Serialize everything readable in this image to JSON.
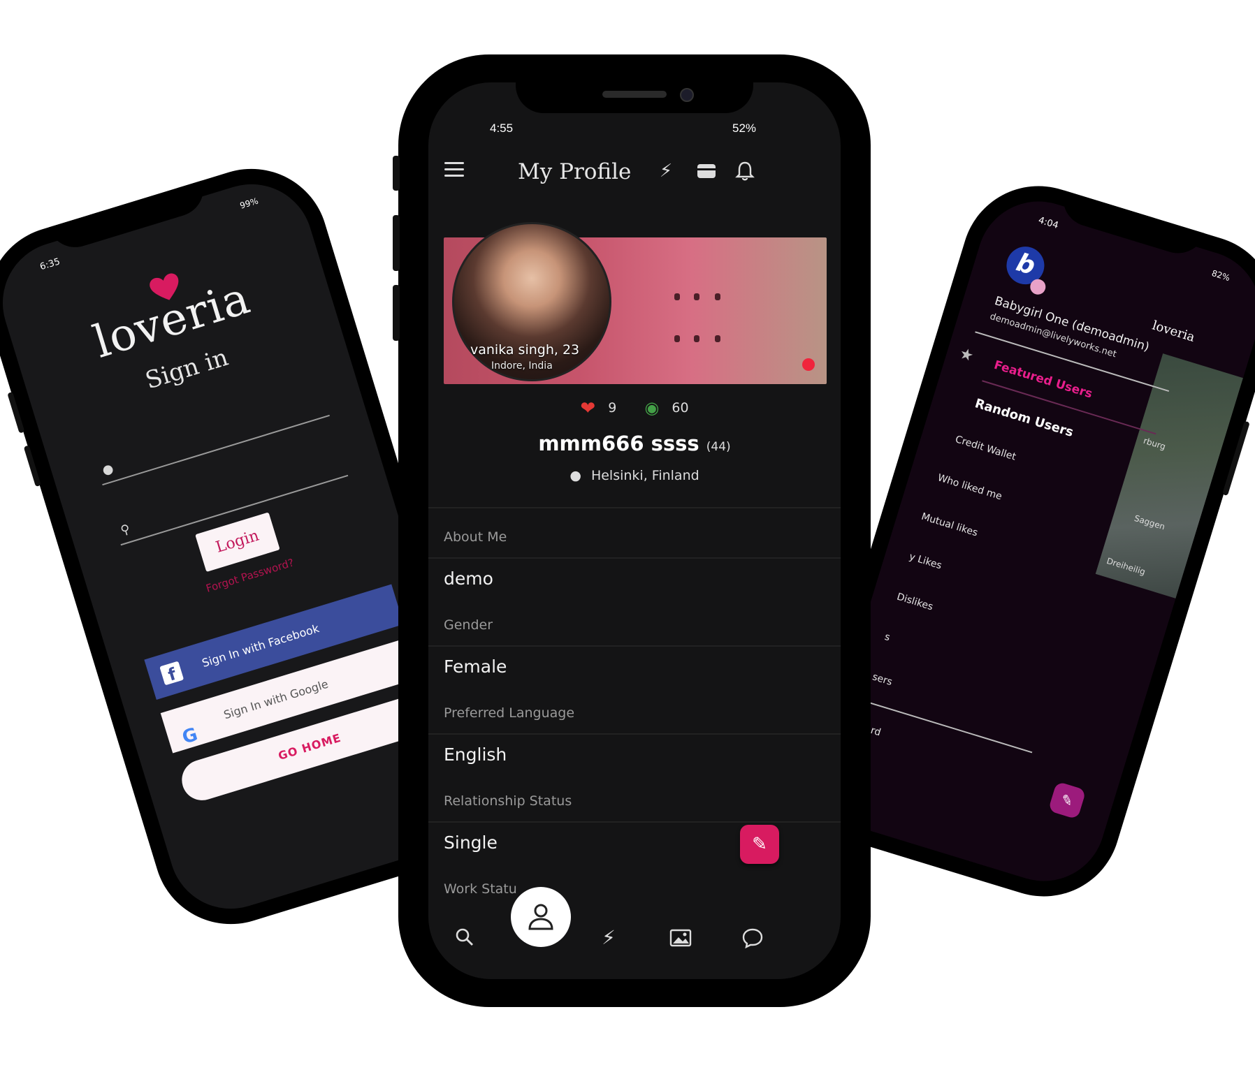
{
  "left_phone": {
    "status_time": "6:35",
    "status_battery": "99%",
    "brand": "loveria",
    "title": "Sign in",
    "login_label": "Login",
    "forgot_label": "Forgot Password?",
    "facebook_label": "Sign In with Facebook",
    "google_label": "Sign In with Google",
    "go_home_label": "GO HOME",
    "icons": {
      "user": "user-icon",
      "key": "key-icon",
      "facebook": "facebook-icon",
      "google": "google-icon"
    }
  },
  "center_phone": {
    "status_time": "4:55",
    "status_battery": "52%",
    "app_title": "My Profile",
    "photo_name": "vanika singh, 23",
    "photo_location": "Indore, India",
    "likes_count": "9",
    "views_count": "60",
    "username": "mmm666 ssss",
    "age": "(44)",
    "location": "Helsinki, Finland",
    "fields": [
      {
        "label": "About Me",
        "value": "demo"
      },
      {
        "label": "Gender",
        "value": "Female"
      },
      {
        "label": "Preferred Language",
        "value": "English"
      },
      {
        "label": "Relationship Status",
        "value": "Single"
      },
      {
        "label": "Work Statu",
        "value": ""
      }
    ],
    "accent_color": "#d81b60"
  },
  "right_phone": {
    "status_time": "4:04",
    "status_battery": "82%",
    "avatar_letter": "b",
    "user_name": "Babygirl One (demoadmin)",
    "user_email": "demoadmin@livelyworks.net",
    "brand": "loveria",
    "menu_items": [
      "Featured Users",
      "Random Users",
      "Credit Wallet",
      "Who liked me",
      "Mutual likes",
      "y Likes",
      "Dislikes",
      "s",
      "sers",
      "word"
    ],
    "map_labels": [
      "rburg",
      "Saggen",
      "Dreiheilig"
    ]
  }
}
